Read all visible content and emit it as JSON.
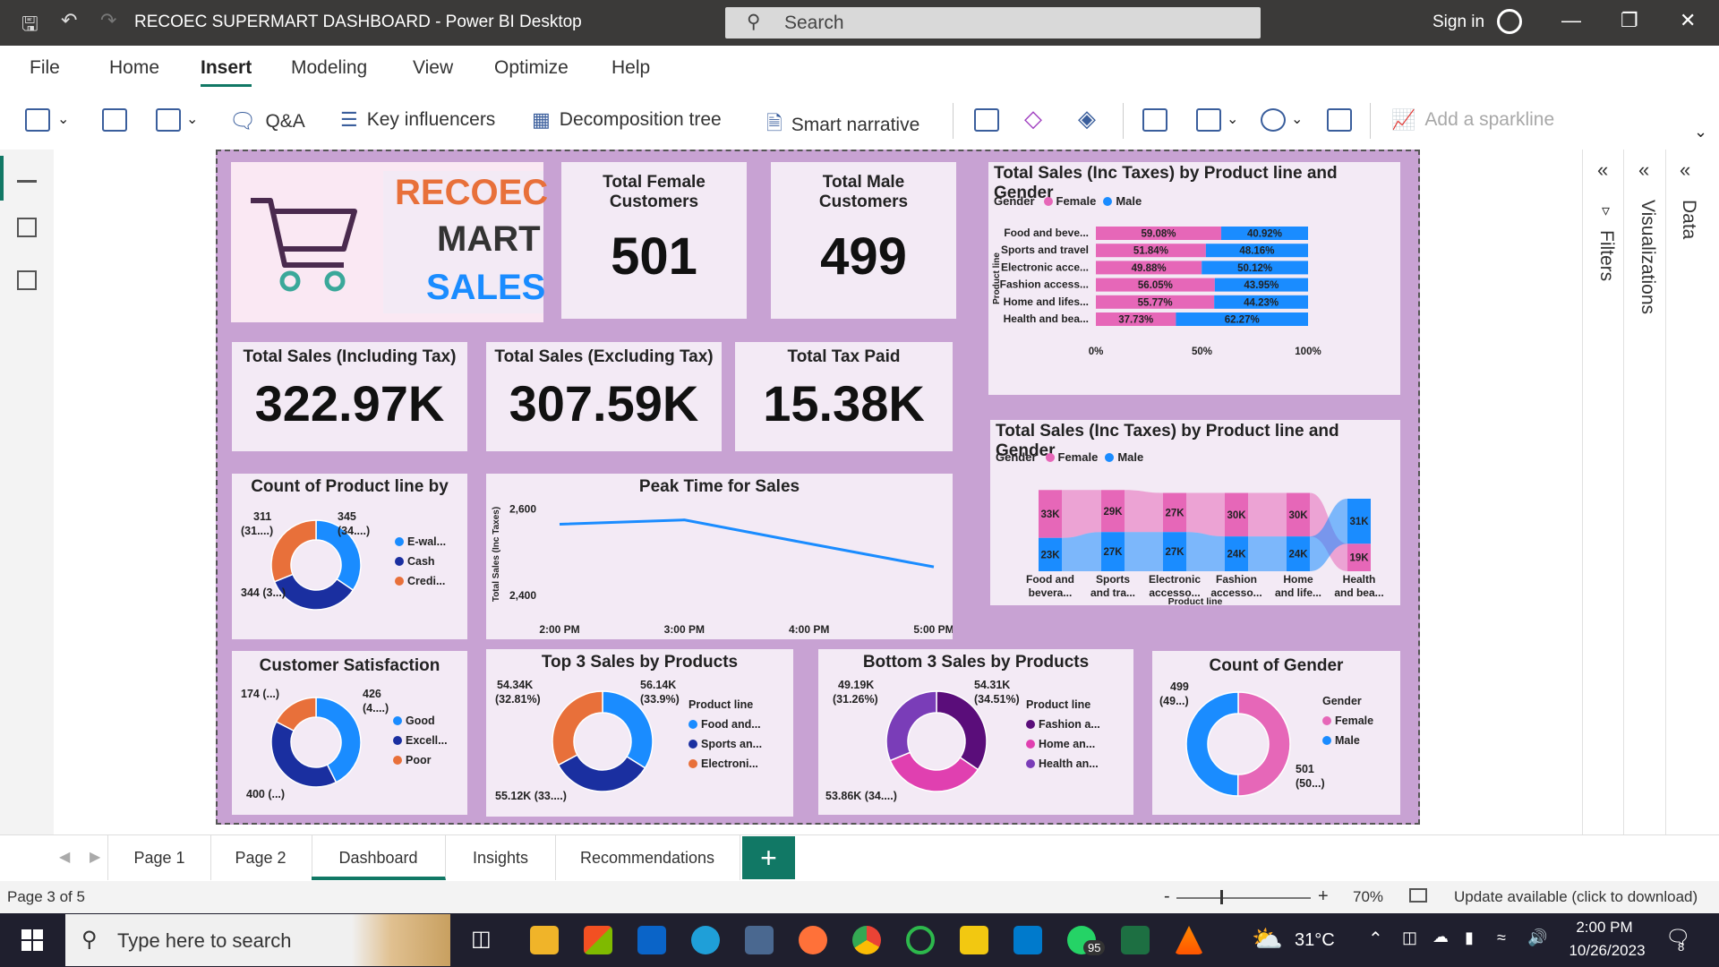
{
  "window": {
    "title": "RECOEC SUPERMART DASHBOARD - Power BI Desktop",
    "search_placeholder": "Search",
    "sign_in": "Sign in"
  },
  "menu": [
    "File",
    "Home",
    "Insert",
    "Modeling",
    "View",
    "Optimize",
    "Help"
  ],
  "toolbar": {
    "qa": "Q&A",
    "key_influencers": "Key influencers",
    "decomposition_tree": "Decomposition tree",
    "smart_narrative": "Smart narrative",
    "add_sparkline": "Add a sparkline"
  },
  "logo": {
    "line1": "RECOEC",
    "line2": "MART",
    "line3": "SALES"
  },
  "kpis": {
    "female_title": "Total Female Customers",
    "female_value": "501",
    "male_title": "Total Male Customers",
    "male_value": "499",
    "sales_inc_title": "Total Sales (Including Tax)",
    "sales_inc_value": "322.97K",
    "sales_exc_title": "Total Sales (Excluding Tax)",
    "sales_exc_value": "307.59K",
    "tax_title": "Total Tax Paid",
    "tax_value": "15.38K"
  },
  "colors": {
    "female": "#e667b8",
    "male": "#1a8cff",
    "navy": "#1a2fa0",
    "orange": "#e8703a",
    "purple": "#7a3db8",
    "darkpurple": "#5a0d7a",
    "pink2": "#e040b0"
  },
  "chart_data": [
    {
      "type": "bar",
      "stacked": "100%",
      "orientation": "horizontal",
      "title": "Total Sales (Inc Taxes) by Product line and Gender",
      "legend_title": "Gender",
      "ylabel": "Product line",
      "categories": [
        "Food and beve...",
        "Sports and travel",
        "Electronic acce...",
        "Fashion access...",
        "Home and lifes...",
        "Health and bea..."
      ],
      "series": [
        {
          "name": "Female",
          "values": [
            59.08,
            51.84,
            49.88,
            56.05,
            55.77,
            37.73
          ],
          "labels": [
            "59.08%",
            "51.84%",
            "49.88%",
            "56.05%",
            "55.77%",
            "37.73%"
          ]
        },
        {
          "name": "Male",
          "values": [
            40.92,
            48.16,
            50.12,
            43.95,
            44.23,
            62.27
          ],
          "labels": [
            "40.92%",
            "48.16%",
            "50.12%",
            "43.95%",
            "44.23%",
            "62.27%"
          ]
        }
      ],
      "x_ticks": [
        "0%",
        "50%",
        "100%"
      ],
      "xlim": [
        0,
        100
      ]
    },
    {
      "type": "bar",
      "subtype": "ribbon",
      "title": "Total Sales (Inc Taxes) by Product line and Gender",
      "legend_title": "Gender",
      "xlabel": "Product line",
      "categories": [
        [
          "Food and",
          "bevera..."
        ],
        [
          "Sports",
          "and tra..."
        ],
        [
          "Electronic",
          "accesso..."
        ],
        [
          "Fashion",
          "accesso..."
        ],
        [
          "Home",
          "and life..."
        ],
        [
          "Health",
          "and bea..."
        ]
      ],
      "series": [
        {
          "name": "Female",
          "values": [
            33,
            29,
            27,
            30,
            30,
            19
          ],
          "labels": [
            "33K",
            "29K",
            "27K",
            "30K",
            "30K",
            "19K"
          ]
        },
        {
          "name": "Male",
          "values": [
            23,
            27,
            27,
            24,
            24,
            31
          ],
          "labels": [
            "23K",
            "27K",
            "27K",
            "24K",
            "24K",
            "31K"
          ]
        }
      ]
    },
    {
      "type": "pie",
      "donut": true,
      "title": "Count of Product line by",
      "labels": [
        "E-wal...",
        "Cash",
        "Credi..."
      ],
      "values": [
        345,
        344,
        311
      ],
      "data_labels": [
        [
          "345",
          "(34....)"
        ],
        [
          "344 (3...)"
        ],
        [
          "311",
          "(31....)"
        ]
      ]
    },
    {
      "type": "line",
      "title": "Peak Time for Sales",
      "ylabel": "Total Sales (Inc Taxes)",
      "x": [
        "2:00 PM",
        "3:00 PM",
        "4:00 PM",
        "5:00 PM"
      ],
      "values": [
        2565,
        2575,
        2520,
        2466
      ],
      "y_ticks": [
        "2,600",
        "2,400"
      ],
      "ylim": [
        2350,
        2620
      ]
    },
    {
      "type": "pie",
      "donut": true,
      "title": "Customer Satisfaction",
      "labels": [
        "Good",
        "Excell...",
        "Poor"
      ],
      "values": [
        426,
        400,
        174
      ],
      "data_labels": [
        [
          "426",
          "(4....)"
        ],
        [
          "400 (...)"
        ],
        [
          "174 (...)"
        ]
      ]
    },
    {
      "type": "pie",
      "donut": true,
      "title": "Top 3 Sales by Products",
      "legend_title": "Product line",
      "labels": [
        "Food and...",
        "Sports an...",
        "Electroni..."
      ],
      "values": [
        56.14,
        55.12,
        54.34
      ],
      "data_labels": [
        [
          "56.14K",
          "(33.9%)"
        ],
        [
          "55.12K (33....)"
        ],
        [
          "54.34K",
          "(32.81%)"
        ]
      ]
    },
    {
      "type": "pie",
      "donut": true,
      "title": "Bottom 3 Sales by Products",
      "legend_title": "Product line",
      "labels": [
        "Fashion a...",
        "Home an...",
        "Health an..."
      ],
      "values": [
        54.31,
        53.86,
        49.19
      ],
      "data_labels": [
        [
          "54.31K",
          "(34.51%)"
        ],
        [
          "53.86K (34....)"
        ],
        [
          "49.19K",
          "(31.26%)"
        ]
      ]
    },
    {
      "type": "pie",
      "donut": true,
      "title": "Count of Gender",
      "legend_title": "Gender",
      "labels": [
        "Female",
        "Male"
      ],
      "values": [
        501,
        499
      ],
      "data_labels": [
        [
          "501",
          "(50...)"
        ],
        [
          "499",
          "(49...)"
        ]
      ]
    }
  ],
  "right_panes": {
    "filters": "Filters",
    "visualizations": "Visualizations",
    "data": "Data"
  },
  "page_tabs": [
    "Page 1",
    "Page 2",
    "Dashboard",
    "Insights",
    "Recommendations"
  ],
  "add_page": "+",
  "status": {
    "page": "Page 3 of 5",
    "zoom_minus": "-",
    "zoom_plus": "+",
    "zoom": "70%",
    "update": "Update available (click to download)"
  },
  "taskbar": {
    "search": "Type here to search",
    "temp": "31°C",
    "time": "2:00 PM",
    "date": "10/26/2023",
    "whatsapp_badge": "95",
    "notif_badge": "8"
  }
}
